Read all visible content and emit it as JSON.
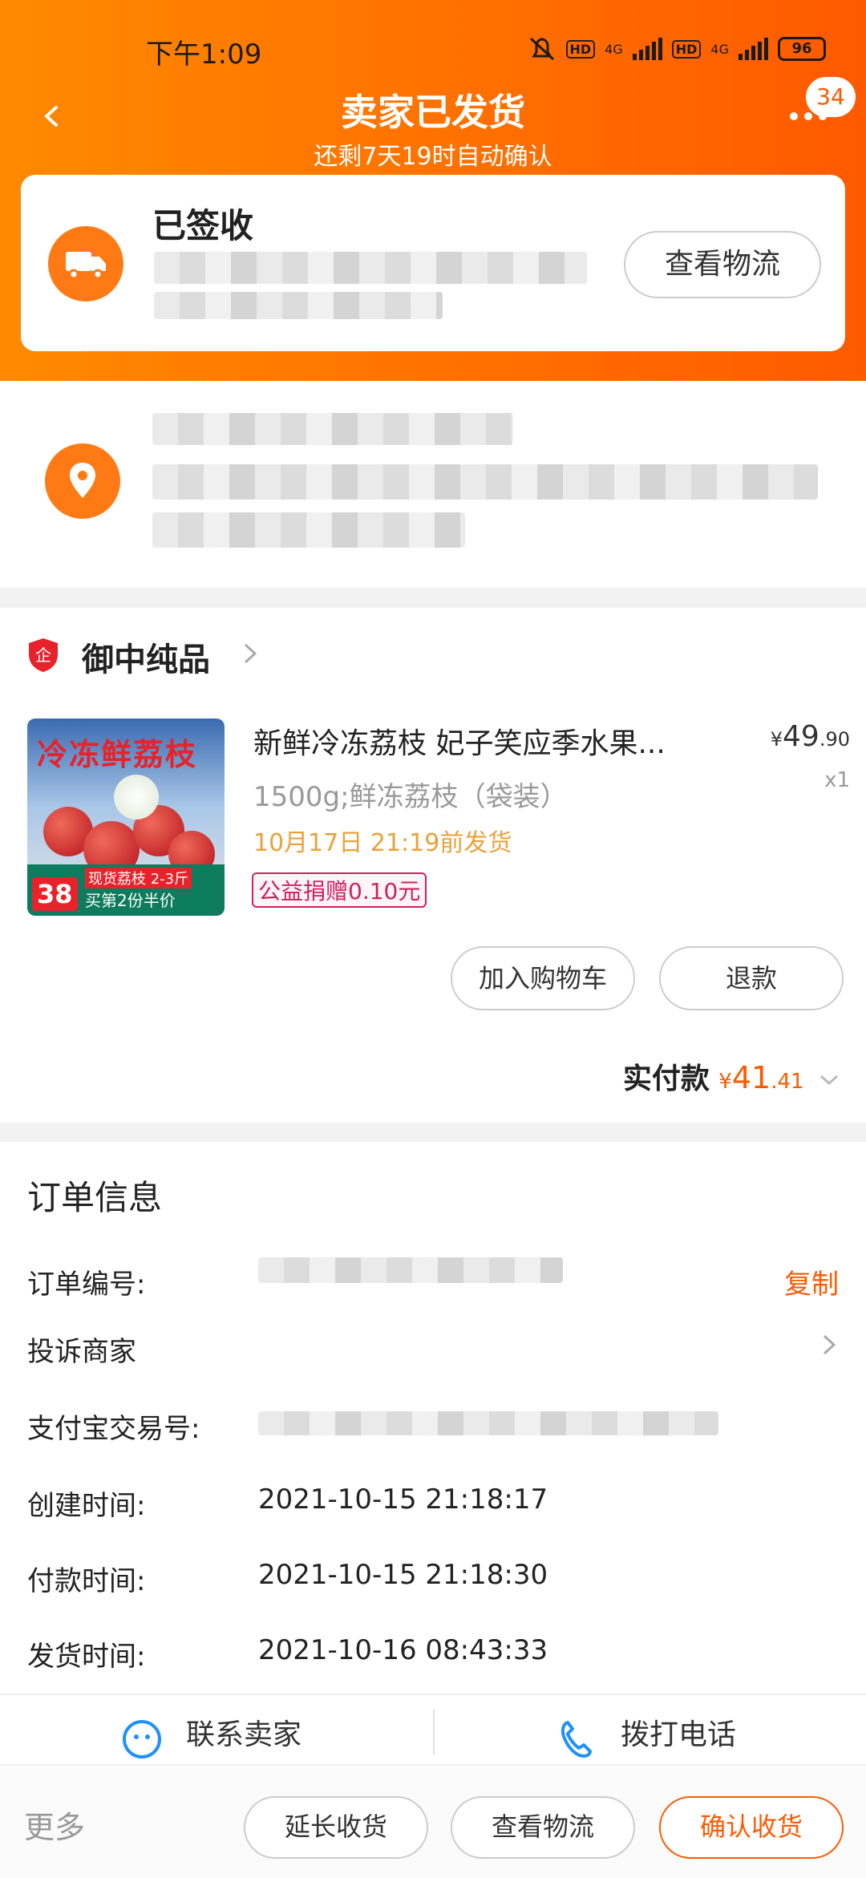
{
  "status_bar": {
    "time": "下午1:09",
    "net1": "4G",
    "net2": "4G",
    "hd": "HD",
    "battery": "96"
  },
  "header": {
    "title": "卖家已发货",
    "subtitle": "还剩7天19时自动确认",
    "badge_count": "34"
  },
  "logistics": {
    "status": "已签收",
    "view_button": "查看物流"
  },
  "shop": {
    "name": "御中纯品",
    "icon_char": "企"
  },
  "product": {
    "image_text": "冷冻鲜荔枝",
    "image_price": "38",
    "image_tag1": "现货荔枝 2-3斤",
    "image_tag2": "买第2份半价",
    "title": "新鲜冷冻荔枝 妃子笑应季水果...",
    "price_symbol": "¥",
    "price_int": "49",
    "price_dec": ".90",
    "qty": "x1",
    "spec": "1500g;鲜冻荔枝（袋装）",
    "ship_by": "10月17日 21:19前发货",
    "charity": "公益捐赠0.10元",
    "add_cart": "加入购物车",
    "refund": "退款"
  },
  "paid": {
    "label": "实付款",
    "symbol": "¥",
    "int": "41",
    "dec": ".41"
  },
  "order_info": {
    "title": "订单信息",
    "order_no_label": "订单编号:",
    "copy": "复制",
    "complaint_label": "投诉商家",
    "alipay_label": "支付宝交易号:",
    "created_label": "创建时间:",
    "created_value": "2021-10-15 21:18:17",
    "paid_label": "付款时间:",
    "paid_value": "2021-10-15 21:18:30",
    "shipped_label": "发货时间:",
    "shipped_value": "2021-10-16 08:43:33"
  },
  "contact": {
    "seller": "联系卖家",
    "call": "拨打电话"
  },
  "bottom_bar": {
    "more": "更多",
    "extend": "延长收货",
    "logistics": "查看物流",
    "confirm": "确认收货"
  },
  "colors": {
    "accent": "#ff5a00",
    "orange_start": "#ff8a00",
    "ship_text": "#e9a23b",
    "charity": "#d0205b"
  }
}
